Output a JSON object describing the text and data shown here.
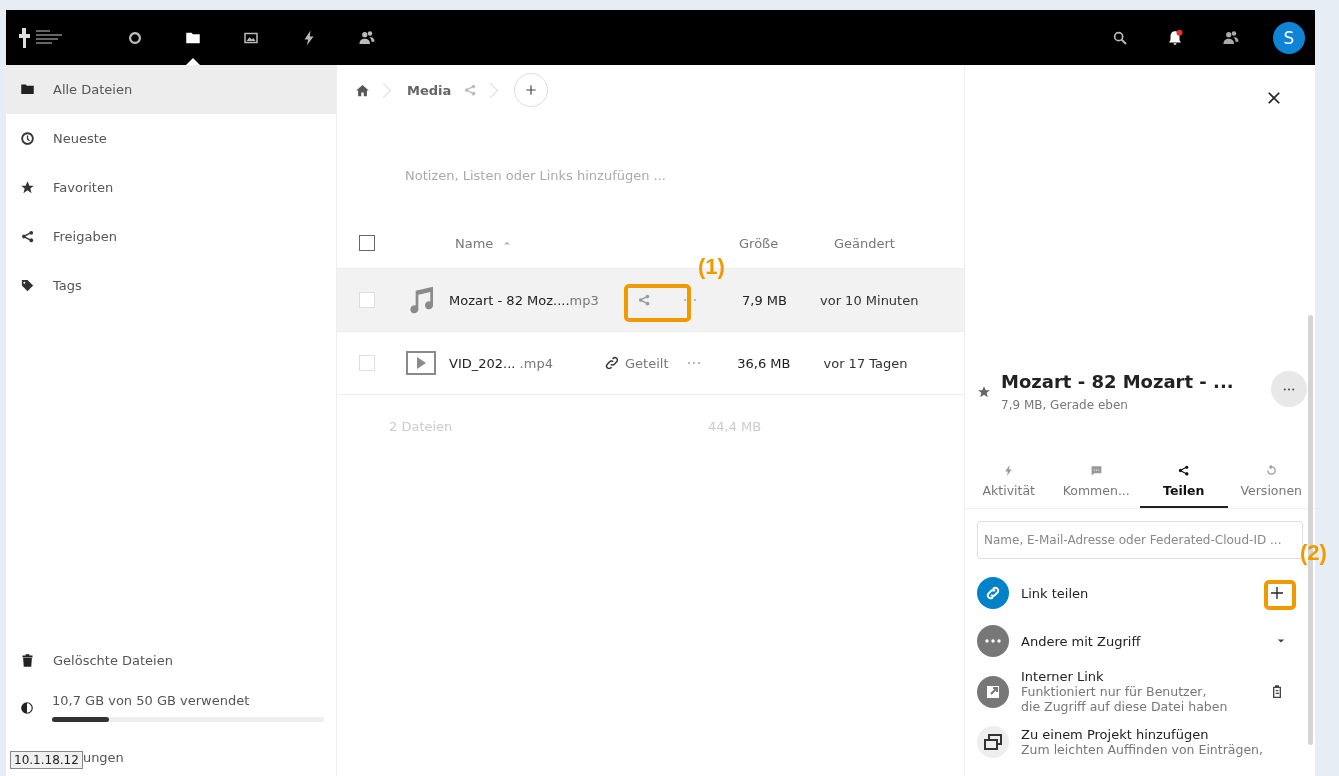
{
  "header": {
    "apps": [
      {
        "selected": false
      },
      {
        "selected": true
      },
      {
        "selected": false
      },
      {
        "selected": false
      },
      {
        "selected": false
      }
    ],
    "notification_unread": true,
    "avatar": "S"
  },
  "sidebar": {
    "items": [
      {
        "label": "Alle Dateien",
        "selected": true
      },
      {
        "label": "Neueste",
        "selected": false
      },
      {
        "label": "Favoriten",
        "selected": false
      },
      {
        "label": "Freigaben",
        "selected": false
      },
      {
        "label": "Tags",
        "selected": false
      }
    ],
    "trash": "Gelöschte Dateien",
    "quota": {
      "label": "10,7 GB von 50 GB verwendet",
      "level": 0.21
    },
    "settings": {
      "label": "ungen",
      "tooltip": "10.1.18.12"
    }
  },
  "breadcrumb": {
    "folder": "Media"
  },
  "notes": {
    "placeholder": "Notizen, Listen oder Links hinzufügen ..."
  },
  "table": {
    "select_all": {
      "checked": false
    },
    "columns": [
      "Name",
      "Größe",
      "Geändert"
    ],
    "rows": [
      {
        "kind": "audio",
        "name": "Mozart - 82 Moz....",
        "ext": "mp3",
        "shared": false,
        "highlighted": true,
        "checked": false,
        "size": "7,9 MB",
        "modified": "vor 10 Minuten"
      },
      {
        "kind": "video",
        "name": "VID_202... ",
        "ext": ".mp4",
        "shared": true,
        "share_label": "Geteilt",
        "highlighted": false,
        "checked": false,
        "size": "36,6 MB",
        "modified": "vor 17 Tagen"
      }
    ],
    "footer": {
      "count": "2 Dateien",
      "total": "44,4 MB"
    }
  },
  "details": {
    "title": "Mozart - 82 Mozart - ...",
    "favorite": false,
    "subtitle": "7,9 MB, Gerade eben",
    "tabs": [
      {
        "label": "Aktivität",
        "selected": false
      },
      {
        "label": "Kommen...",
        "selected": false
      },
      {
        "label": "Teilen",
        "selected": true
      },
      {
        "label": "Versionen",
        "selected": false
      }
    ],
    "search": {
      "placeholder": "Name, E-Mail-Adresse oder Federated-Cloud-ID ..."
    },
    "shares": [
      {
        "kind": "link",
        "title": "Link teilen"
      },
      {
        "kind": "others",
        "title": "Andere mit Zugriff"
      },
      {
        "kind": "internal",
        "title": "Interner Link",
        "subtitle": "Funktioniert nur für Benutzer,\ndie Zugriff auf diese Datei haben"
      },
      {
        "kind": "project",
        "title": "Zu einem Projekt hinzufügen",
        "subtitle": "Zum leichten Auffinden von Einträgen,"
      }
    ]
  },
  "annotations": [
    {
      "label": "(1)"
    },
    {
      "label": "(2)"
    }
  ]
}
